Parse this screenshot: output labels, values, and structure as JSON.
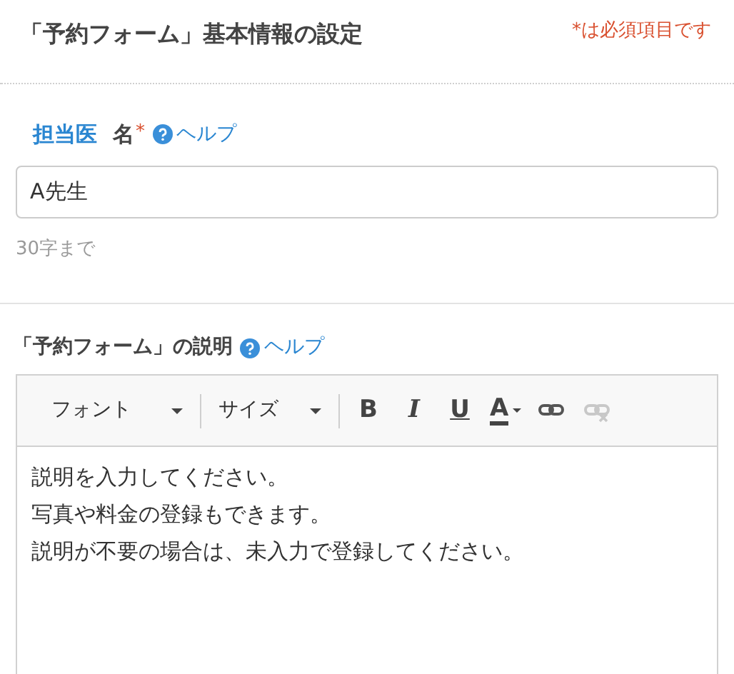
{
  "header": {
    "title": "「予約フォーム」基本情報の設定",
    "required_note": "*は必須項目です"
  },
  "name_field": {
    "label_highlight": "担当医",
    "label_rest": "名",
    "required_mark": "*",
    "help": "ヘルプ",
    "value": "A先生",
    "hint": "30字まで"
  },
  "description": {
    "label": "「予約フォーム」の説明",
    "help": "ヘルプ",
    "toolbar": [
      {
        "kind": "dropdown",
        "label": "フォント"
      },
      {
        "kind": "dropdown",
        "label": "サイズ"
      },
      {
        "kind": "bold",
        "label": "B"
      },
      {
        "kind": "italic",
        "label": "I"
      },
      {
        "kind": "underline",
        "label": "U"
      },
      {
        "kind": "color",
        "label": "A"
      },
      {
        "kind": "link",
        "disabled": false
      },
      {
        "kind": "unlink",
        "disabled": true
      }
    ],
    "lines": [
      "説明を入力してください。",
      "写真や料金の登録もできます。",
      "説明が不要の場合は、未入力で登録してください。"
    ]
  }
}
